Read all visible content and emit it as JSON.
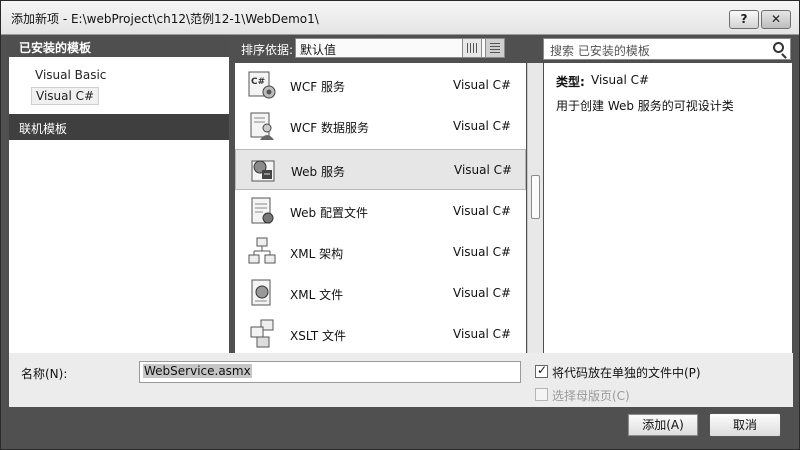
{
  "window": {
    "title": "添加新项 - E:\\webProject\\ch12\\范例12-1\\WebDemo1\\",
    "help_label": "?",
    "close_label": "✕"
  },
  "left_panel": {
    "header": "已安装的模板",
    "items": [
      {
        "label": "Visual Basic",
        "selected": false
      },
      {
        "label": "Visual C#",
        "selected": true
      }
    ],
    "online_label": "联机模板"
  },
  "sort": {
    "label": "排序依据:",
    "selected": "默认值"
  },
  "search": {
    "placeholder": "搜索 已安装的模板",
    "icon": "search-icon"
  },
  "templates": [
    {
      "name": "WCF 服务",
      "type": "Visual C#",
      "icon": "wcf-service-icon",
      "selected": false
    },
    {
      "name": "WCF 数据服务",
      "type": "Visual C#",
      "icon": "wcf-data-service-icon",
      "selected": false
    },
    {
      "name": "Web 服务",
      "type": "Visual C#",
      "icon": "web-service-icon",
      "selected": true
    },
    {
      "name": "Web 配置文件",
      "type": "Visual C#",
      "icon": "web-config-icon",
      "selected": false
    },
    {
      "name": "XML 架构",
      "type": "Visual C#",
      "icon": "xml-schema-icon",
      "selected": false
    },
    {
      "name": "XML 文件",
      "type": "Visual C#",
      "icon": "xml-file-icon",
      "selected": false
    },
    {
      "name": "XSLT 文件",
      "type": "Visual C#",
      "icon": "xslt-file-icon",
      "selected": false
    }
  ],
  "description": {
    "type_label": "类型:",
    "type_value": "Visual C#",
    "text": "用于创建 Web 服务的可视设计类"
  },
  "name_field": {
    "label": "名称(N):",
    "value": "WebService.asmx"
  },
  "options": {
    "separate_code": {
      "label": "将代码放在单独的文件中(P)",
      "checked": true
    },
    "master_page": {
      "label": "选择母版页(C)",
      "checked": false,
      "disabled": true
    }
  },
  "buttons": {
    "add": "添加(A)",
    "cancel": "取消"
  }
}
